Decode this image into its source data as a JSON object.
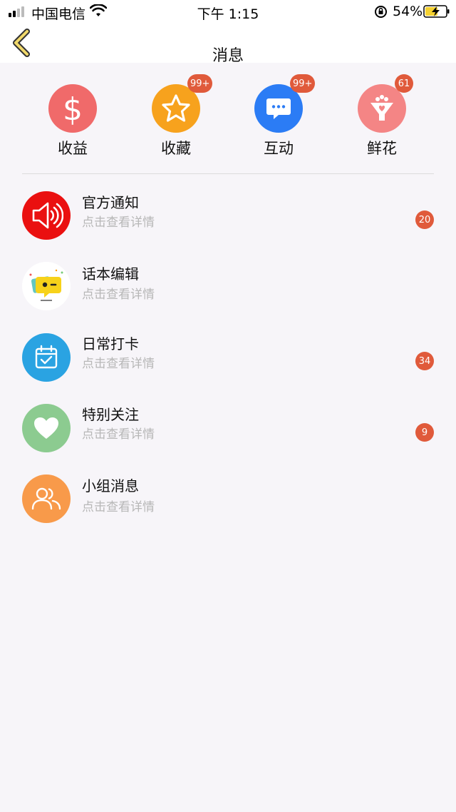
{
  "status_bar": {
    "carrier": "中国电信",
    "time": "下午 1:15",
    "battery": "54%"
  },
  "nav": {
    "title": "消息",
    "back_icon": "chevron-left-icon"
  },
  "shortcuts": [
    {
      "label": "收益",
      "icon": "dollar-icon",
      "color": "#f06a6a",
      "badge": ""
    },
    {
      "label": "收藏",
      "icon": "star-icon",
      "color": "#f7a21d",
      "badge": "99+"
    },
    {
      "label": "互动",
      "icon": "chat-bubble-icon",
      "color": "#2b7cf5",
      "badge": "99+"
    },
    {
      "label": "鲜花",
      "icon": "flower-bouquet-icon",
      "color": "#f48585",
      "badge": "61"
    }
  ],
  "messages": [
    {
      "title": "官方通知",
      "subtitle": "点击查看详情",
      "badge": "20",
      "icon": "speaker-icon",
      "color": "#ea1010"
    },
    {
      "title": "话本编辑",
      "subtitle": "点击查看详情",
      "badge": "",
      "icon": "editor-chat-icon",
      "color": "#ffffff"
    },
    {
      "title": "日常打卡",
      "subtitle": "点击查看详情",
      "badge": "34",
      "icon": "calendar-check-icon",
      "color": "#2aa3e2"
    },
    {
      "title": "特别关注",
      "subtitle": "点击查看详情",
      "badge": "9",
      "icon": "heart-icon",
      "color": "#8ccb90"
    },
    {
      "title": "小组消息",
      "subtitle": "点击查看详情",
      "badge": "",
      "icon": "group-icon",
      "color": "#f89a4a"
    }
  ]
}
